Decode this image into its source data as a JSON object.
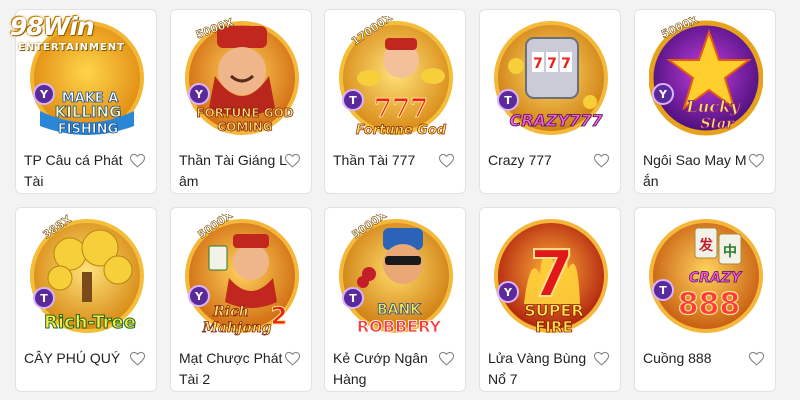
{
  "brand": {
    "logo_main": "98Win",
    "logo_sub": "ENTERTAINMENT"
  },
  "colors": {
    "card_bg": "#ffffff",
    "ring_gold": "#e7a21c",
    "badge_purple": "#5b2a9a"
  },
  "games": [
    {
      "title": "TP Câu cá Phát Tài",
      "art_text": "MAKE A KILLING FISHING",
      "badge": "Y",
      "theme": "fishing"
    },
    {
      "title": "Thần Tài Giáng Lâm",
      "art_text": "FORTUNE GOD COMING",
      "multiplier": "5000X",
      "badge": "Y",
      "theme": "god"
    },
    {
      "title": "Thần Tài 777",
      "art_text": "777 Fortune God",
      "multiplier": "17000X",
      "badge": "T",
      "theme": "god777"
    },
    {
      "title": "Crazy 777",
      "art_text": "CRAZY777",
      "badge": "T",
      "theme": "crazy777"
    },
    {
      "title": "Ngôi Sao May Mắn",
      "art_text": "Lucky Star",
      "multiplier": "5000X",
      "badge": "Y",
      "theme": "star"
    },
    {
      "title": "CÂY PHÚ QUÝ",
      "art_text": "Rich-Tree",
      "multiplier": "388X",
      "badge": "T",
      "theme": "tree"
    },
    {
      "title": "Mạt Chược Phát Tài 2",
      "art_text": "Rich Mahjong 2",
      "multiplier": "5000X",
      "badge": "Y",
      "theme": "mahjong"
    },
    {
      "title": "Kẻ Cướp Ngân Hàng",
      "art_text": "BANK ROBBERY",
      "multiplier": "5000X",
      "badge": "T",
      "theme": "robbery"
    },
    {
      "title": "Lửa Vàng Bùng Nổ 7",
      "art_text": "7 SUPER FIRE",
      "badge": "Y",
      "theme": "fire"
    },
    {
      "title": "Cuồng 888",
      "art_text": "CRAZY 888",
      "badge": "T",
      "theme": "888"
    }
  ]
}
